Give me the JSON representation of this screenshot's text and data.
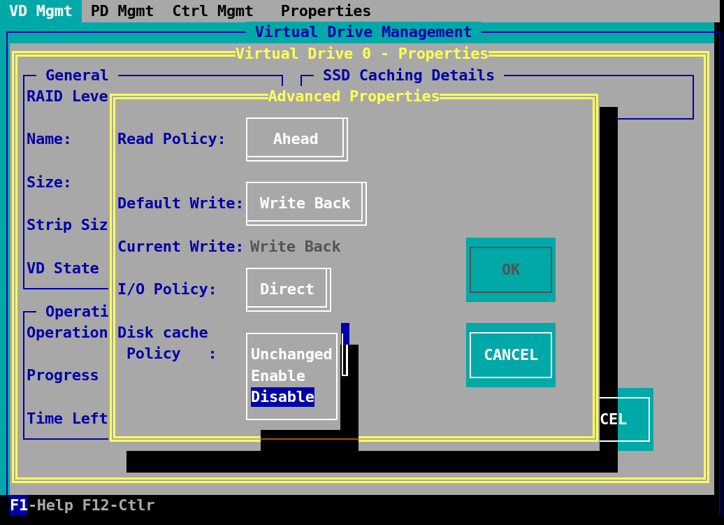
{
  "menu": [
    {
      "label": "VD Mgmt",
      "selected": true
    },
    {
      "label": "PD Mgmt",
      "selected": false
    },
    {
      "label": "Ctrl Mgmt",
      "selected": false
    },
    {
      "label": "Properties",
      "selected": false
    }
  ],
  "management_frame": {
    "title": "Virtual Drive Management"
  },
  "properties_window": {
    "title": "Virtual Drive 0 - Properties",
    "general": {
      "title": "General",
      "labels": [
        "RAID Leve",
        "Name:",
        "Size:",
        "Strip Siz",
        "VD State"
      ]
    },
    "ssd_caching": {
      "title": "SSD Caching Details"
    },
    "operation": {
      "title": "Operati",
      "labels": [
        "Operation",
        "Progress",
        "Time Left"
      ]
    },
    "cancel_button": {
      "label": "CEL"
    }
  },
  "advanced_dialog": {
    "title": "Advanced Properties",
    "fields": [
      {
        "kind": "button",
        "label": "Read Policy:",
        "value": "Ahead"
      },
      {
        "kind": "button",
        "label": "Default Write:",
        "value": "Write Back"
      },
      {
        "kind": "readonly",
        "label": "Current Write:",
        "value": "Write Back"
      },
      {
        "kind": "button",
        "label": "I/O Policy:",
        "value": "Direct"
      },
      {
        "kind": "dropdown",
        "label_lines": [
          "Disk cache",
          "Policy   :"
        ],
        "options": [
          {
            "label": "Unchanged",
            "selected": false
          },
          {
            "label": "Enable",
            "selected": false
          },
          {
            "label": "Disable",
            "selected": true
          }
        ]
      }
    ],
    "buttons": [
      {
        "label": "OK",
        "disabled": true
      },
      {
        "label": "CANCEL",
        "disabled": false
      }
    ]
  },
  "status_bar": {
    "items": [
      {
        "text": "F1",
        "highlighted": true
      },
      {
        "text": "-Help F12-Ctlr",
        "highlighted": false
      }
    ]
  }
}
